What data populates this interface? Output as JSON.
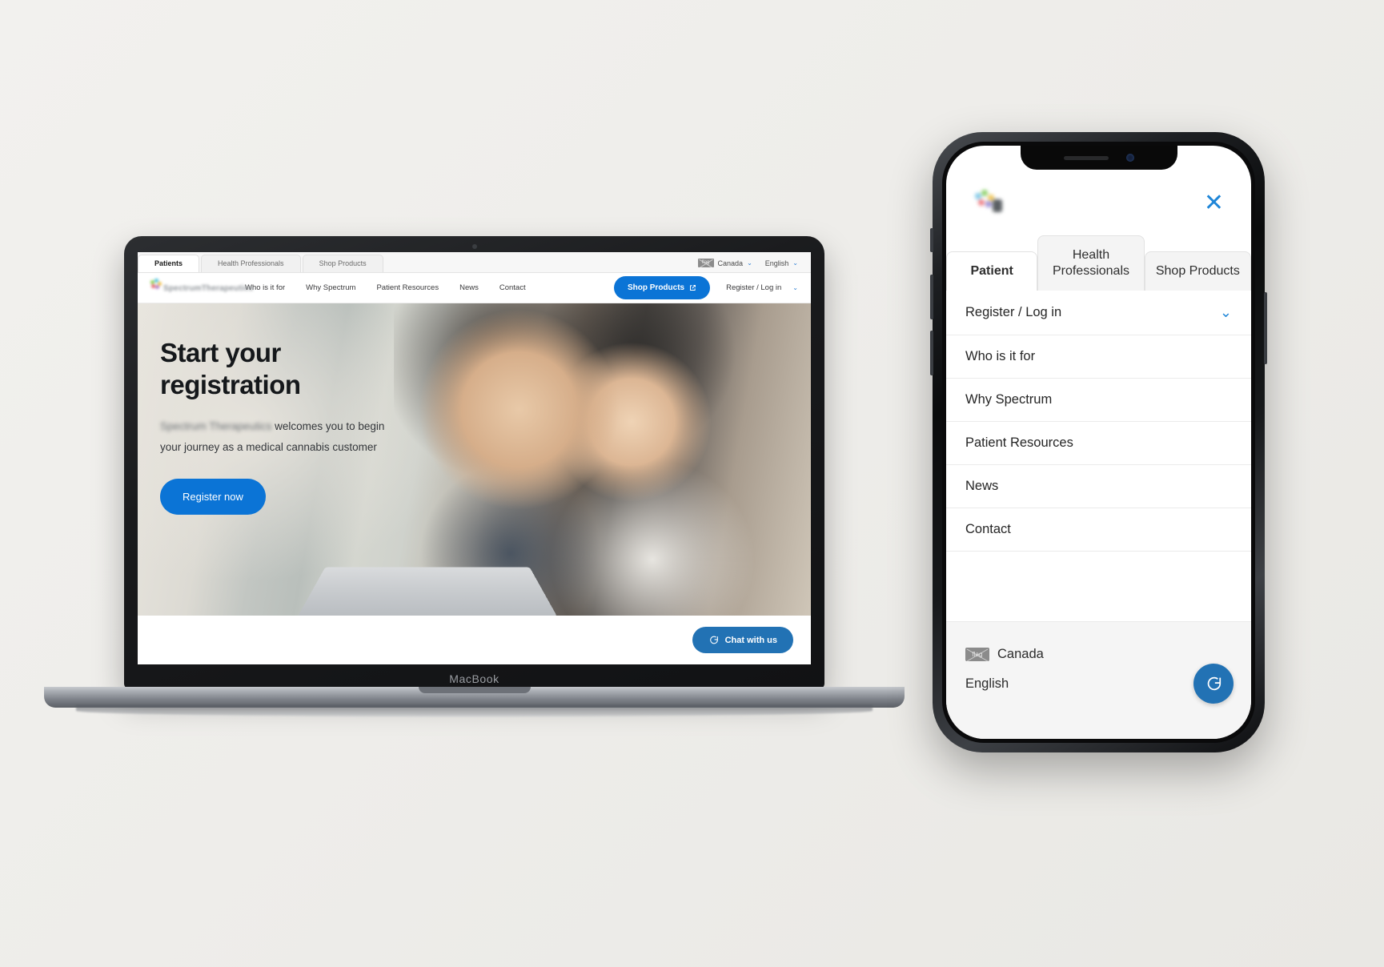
{
  "desktop": {
    "device_label": "MacBook",
    "browser_tabs": [
      {
        "label": "Patients",
        "active": true
      },
      {
        "label": "Health Professionals",
        "active": false
      },
      {
        "label": "Shop Products",
        "active": false
      }
    ],
    "locale": {
      "country": "Canada",
      "country_flag_alt": "flag",
      "language": "English",
      "caret": "⌄"
    },
    "brand": {
      "wordmark": "SpectrumTherapeutics"
    },
    "nav_links": [
      "Who is it for",
      "Why Spectrum",
      "Patient Resources",
      "News",
      "Contact"
    ],
    "shop_button": {
      "label": "Shop Products",
      "icon": "external-link-icon"
    },
    "register_login": {
      "label": "Register / Log in",
      "caret": "⌄"
    },
    "hero": {
      "heading_line1": "Start your",
      "heading_line2": "registration",
      "body_blurred": "Spectrum Therapeutics",
      "body_rest": " welcomes you to begin your journey as a medical cannabis customer",
      "cta_label": "Register now"
    },
    "chat": {
      "label": "Chat with us",
      "icon": "chat-bubble-icon"
    }
  },
  "mobile": {
    "close_label": "✕",
    "tabs": [
      {
        "label": "Patient",
        "active": true
      },
      {
        "label": "Health Professionals",
        "active": false
      },
      {
        "label": "Shop Products",
        "active": false
      }
    ],
    "menu_items": [
      {
        "label": "Register / Log in",
        "has_chevron": true,
        "chevron": "⌄"
      },
      {
        "label": "Who is it for",
        "has_chevron": false
      },
      {
        "label": "Why Spectrum",
        "has_chevron": false
      },
      {
        "label": "Patient Resources",
        "has_chevron": false
      },
      {
        "label": "News",
        "has_chevron": false
      },
      {
        "label": "Contact",
        "has_chevron": false
      }
    ],
    "footer": {
      "country": "Canada",
      "country_flag_alt": "flag",
      "language": "English"
    },
    "chat_icon": "chat-bubble-icon"
  },
  "colors": {
    "brand_blue": "#0b74d6",
    "chat_blue": "#2272b4",
    "link_blue": "#1f86d8",
    "page_background": "#efeeeb",
    "text_dark": "#15181b"
  }
}
